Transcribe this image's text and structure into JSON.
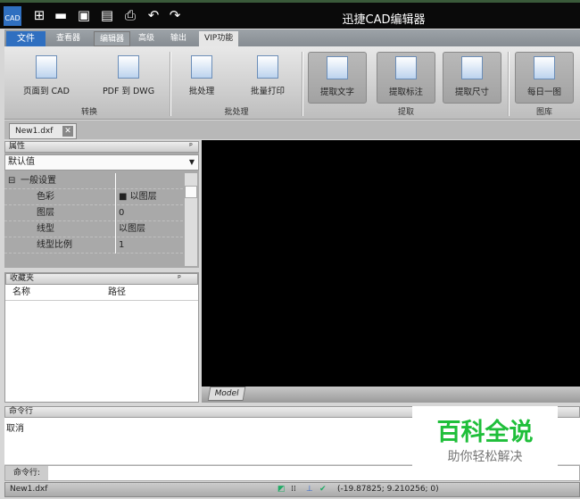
{
  "app": {
    "title": "迅捷CAD编辑器",
    "logo": "CAD"
  },
  "quick_access": [
    "new-icon",
    "open-icon",
    "save-icon",
    "save-as-icon",
    "print-icon",
    "undo-icon",
    "redo-icon"
  ],
  "menu_tabs": [
    "文件",
    "查看器",
    "编辑器",
    "高级",
    "输出",
    "VIP功能"
  ],
  "ribbon": {
    "groups": [
      {
        "label": "转换",
        "buttons": [
          "页面到 CAD",
          "PDF 到 DWG"
        ]
      },
      {
        "label": "批处理",
        "buttons": [
          "批处理",
          "批量打印"
        ]
      },
      {
        "label": "提取",
        "buttons": [
          "提取文字",
          "提取标注",
          "提取尺寸"
        ]
      },
      {
        "label": "图库",
        "buttons": [
          "每日一图"
        ]
      }
    ]
  },
  "document_tab": "New1.dxf",
  "properties": {
    "title": "属性",
    "selector": "默认值",
    "section": "一般设置",
    "rows": [
      {
        "k": "色彩",
        "v": "■ 以图层"
      },
      {
        "k": "图层",
        "v": "0"
      },
      {
        "k": "线型",
        "v": "以图层"
      },
      {
        "k": "线型比例",
        "v": "1"
      }
    ]
  },
  "favorites": {
    "title": "收藏夹",
    "col_name": "名称",
    "col_path": "路径"
  },
  "model_tab": "Model",
  "command": {
    "title": "命令行",
    "output": "取消",
    "input_label": "命令行:",
    "input_value": ""
  },
  "status": {
    "file": "New1.dxf",
    "coords": "(-19.87825; 9.210256; 0)"
  },
  "watermark": {
    "title": "百科全说",
    "subtitle": "助你轻松解决"
  }
}
